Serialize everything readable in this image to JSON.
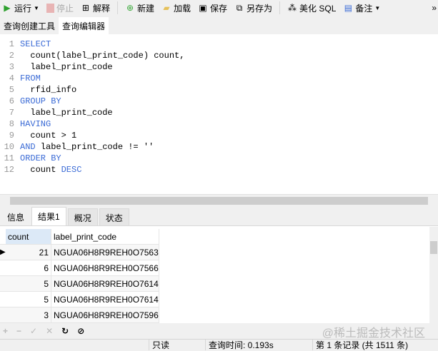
{
  "toolbar": {
    "run": "运行",
    "stop": "停止",
    "explain": "解释",
    "new": "新建",
    "load": "加载",
    "save": "保存",
    "save_as": "另存为",
    "beautify": "美化 SQL",
    "note": "备注",
    "more": "»"
  },
  "tabs": [
    "查询创建工具",
    "查询编辑器"
  ],
  "editor": {
    "lines": [
      [
        [
          "kw",
          "SELECT"
        ]
      ],
      [
        [
          "",
          "  count(label_print_code) count,"
        ]
      ],
      [
        [
          "",
          "  label_print_code"
        ]
      ],
      [
        [
          "kw",
          "FROM"
        ]
      ],
      [
        [
          "",
          "  rfid_info"
        ]
      ],
      [
        [
          "kw",
          "GROUP BY"
        ]
      ],
      [
        [
          "",
          "  label_print_code"
        ]
      ],
      [
        [
          "kw",
          "HAVING"
        ]
      ],
      [
        [
          "",
          "  count > 1"
        ]
      ],
      [
        [
          "kw",
          "AND"
        ],
        [
          "",
          " label_print_code != ''"
        ]
      ],
      [
        [
          "kw",
          "ORDER BY"
        ]
      ],
      [
        [
          "",
          "  count "
        ],
        [
          "kw",
          "DESC"
        ]
      ]
    ]
  },
  "result_tabs": [
    "信息",
    "结果1",
    "概况",
    "状态"
  ],
  "grid": {
    "columns": [
      "count",
      "label_print_code"
    ],
    "rows": [
      [
        "21",
        "NGUA06H8R9REH0O7563"
      ],
      [
        "6",
        "NGUA06H8R9REH0O7566"
      ],
      [
        "5",
        "NGUA06H8R9REH0O7614"
      ],
      [
        "5",
        "NGUA06H8R9REH0O7614"
      ],
      [
        "3",
        "NGUA06H8R9REH0O7596"
      ]
    ]
  },
  "status": {
    "readonly": "只读",
    "query_time": "查询时间: 0.193s",
    "record": "第 1 条记录 (共 1511 条)"
  },
  "watermark": "@稀土掘金技术社区"
}
